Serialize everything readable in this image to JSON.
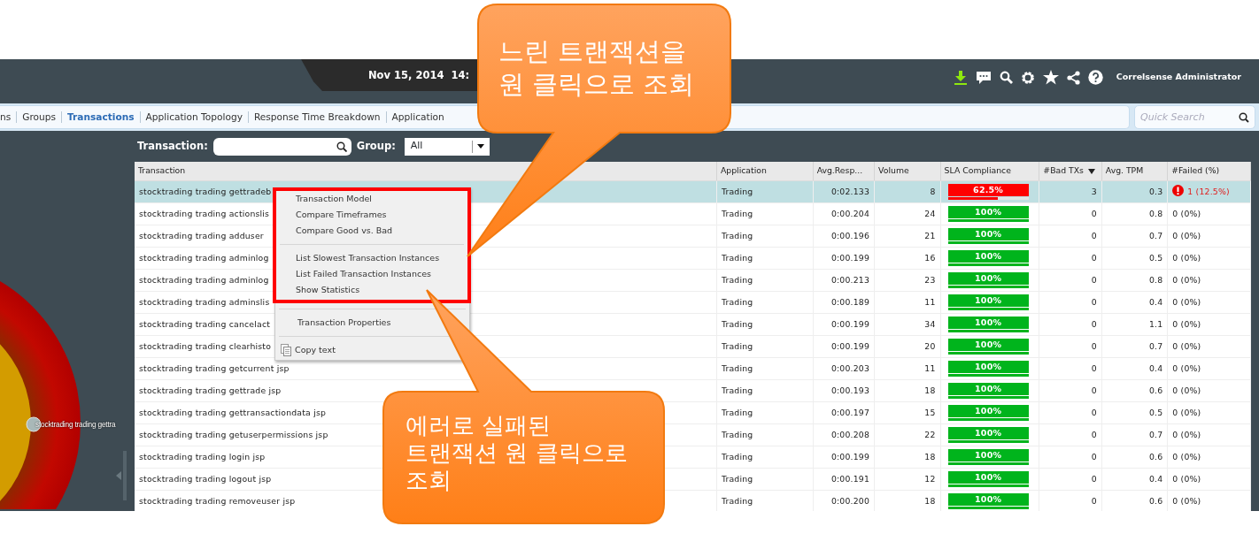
{
  "header": {
    "date": "Nov 15, 2014  14:",
    "user": "Correlsense Administrator"
  },
  "nav": {
    "items": [
      {
        "label": "ns",
        "selected": false
      },
      {
        "label": "Groups",
        "selected": false
      },
      {
        "label": "Transactions",
        "selected": true
      },
      {
        "label": "Application Topology",
        "selected": false
      },
      {
        "label": "Response Time Breakdown",
        "selected": false
      },
      {
        "label": "Application",
        "selected": false
      }
    ],
    "search_placeholder": "Quick Search"
  },
  "graph": {
    "node_label": "stocktrading trading gettra"
  },
  "filters": {
    "transaction_label": "Transaction:",
    "group_label": "Group:",
    "group_value": "All"
  },
  "table": {
    "columns": [
      {
        "label": "Transaction",
        "sorted": false
      },
      {
        "label": "Application",
        "sorted": false
      },
      {
        "label": "Avg.Resp...",
        "sorted": false
      },
      {
        "label": "Volume",
        "sorted": false
      },
      {
        "label": "SLA Compliance",
        "sorted": false
      },
      {
        "label": "#Bad TXs",
        "sorted": true
      },
      {
        "label": "Avg. TPM",
        "sorted": false
      },
      {
        "label": "#Failed (%)",
        "sorted": false
      }
    ],
    "rows": [
      {
        "name": "stocktrading trading gettradeb",
        "application": "Trading",
        "avg_resp": "0:02.133",
        "volume": "8",
        "sla": {
          "text": "62.5%",
          "level": 0.625,
          "color": "#fe0000"
        },
        "bad_txs": "3",
        "avg_tpm": "0.3",
        "failed": "1 (12.5%)",
        "failed_alert": true,
        "selected": true
      },
      {
        "name": "stocktrading trading actionslis",
        "application": "Trading",
        "avg_resp": "0:00.204",
        "volume": "24",
        "sla": {
          "text": "100%",
          "level": 1,
          "color": "#00b41c"
        },
        "bad_txs": "0",
        "avg_tpm": "0.8",
        "failed": "0 (0%)",
        "failed_alert": false,
        "selected": false
      },
      {
        "name": "stocktrading trading adduser",
        "application": "Trading",
        "avg_resp": "0:00.196",
        "volume": "21",
        "sla": {
          "text": "100%",
          "level": 1,
          "color": "#00b41c"
        },
        "bad_txs": "0",
        "avg_tpm": "0.7",
        "failed": "0 (0%)",
        "failed_alert": false,
        "selected": false
      },
      {
        "name": "stocktrading trading adminlog",
        "application": "Trading",
        "avg_resp": "0:00.199",
        "volume": "16",
        "sla": {
          "text": "100%",
          "level": 1,
          "color": "#00b41c"
        },
        "bad_txs": "0",
        "avg_tpm": "0.5",
        "failed": "0 (0%)",
        "failed_alert": false,
        "selected": false
      },
      {
        "name": "stocktrading trading adminlog",
        "application": "Trading",
        "avg_resp": "0:00.213",
        "volume": "23",
        "sla": {
          "text": "100%",
          "level": 1,
          "color": "#00b41c"
        },
        "bad_txs": "0",
        "avg_tpm": "0.8",
        "failed": "0 (0%)",
        "failed_alert": false,
        "selected": false
      },
      {
        "name": "stocktrading trading adminslis",
        "application": "Trading",
        "avg_resp": "0:00.189",
        "volume": "11",
        "sla": {
          "text": "100%",
          "level": 1,
          "color": "#00b41c"
        },
        "bad_txs": "0",
        "avg_tpm": "0.4",
        "failed": "0 (0%)",
        "failed_alert": false,
        "selected": false
      },
      {
        "name": "stocktrading trading cancelact",
        "application": "Trading",
        "avg_resp": "0:00.199",
        "volume": "34",
        "sla": {
          "text": "100%",
          "level": 1,
          "color": "#00b41c"
        },
        "bad_txs": "0",
        "avg_tpm": "1.1",
        "failed": "0 (0%)",
        "failed_alert": false,
        "selected": false
      },
      {
        "name": "stocktrading trading clearhisto",
        "application": "Trading",
        "avg_resp": "0:00.199",
        "volume": "20",
        "sla": {
          "text": "100%",
          "level": 1,
          "color": "#00b41c"
        },
        "bad_txs": "0",
        "avg_tpm": "0.7",
        "failed": "0 (0%)",
        "failed_alert": false,
        "selected": false
      },
      {
        "name": "stocktrading trading getcurrent jsp",
        "application": "Trading",
        "avg_resp": "0:00.203",
        "volume": "11",
        "sla": {
          "text": "100%",
          "level": 1,
          "color": "#00b41c"
        },
        "bad_txs": "0",
        "avg_tpm": "0.4",
        "failed": "0 (0%)",
        "failed_alert": false,
        "selected": false
      },
      {
        "name": "stocktrading trading gettrade jsp",
        "application": "Trading",
        "avg_resp": "0:00.193",
        "volume": "18",
        "sla": {
          "text": "100%",
          "level": 1,
          "color": "#00b41c"
        },
        "bad_txs": "0",
        "avg_tpm": "0.6",
        "failed": "0 (0%)",
        "failed_alert": false,
        "selected": false
      },
      {
        "name": "stocktrading trading gettransactiondata jsp",
        "application": "Trading",
        "avg_resp": "0:00.197",
        "volume": "15",
        "sla": {
          "text": "100%",
          "level": 1,
          "color": "#00b41c"
        },
        "bad_txs": "0",
        "avg_tpm": "0.5",
        "failed": "0 (0%)",
        "failed_alert": false,
        "selected": false
      },
      {
        "name": "stocktrading trading getuserpermissions jsp",
        "application": "Trading",
        "avg_resp": "0:00.208",
        "volume": "22",
        "sla": {
          "text": "100%",
          "level": 1,
          "color": "#00b41c"
        },
        "bad_txs": "0",
        "avg_tpm": "0.7",
        "failed": "0 (0%)",
        "failed_alert": false,
        "selected": false
      },
      {
        "name": "stocktrading trading login jsp",
        "application": "Trading",
        "avg_resp": "0:00.199",
        "volume": "18",
        "sla": {
          "text": "100%",
          "level": 1,
          "color": "#00b41c"
        },
        "bad_txs": "0",
        "avg_tpm": "0.6",
        "failed": "0 (0%)",
        "failed_alert": false,
        "selected": false
      },
      {
        "name": "stocktrading trading logout jsp",
        "application": "Trading",
        "avg_resp": "0:00.191",
        "volume": "12",
        "sla": {
          "text": "100%",
          "level": 1,
          "color": "#00b41c"
        },
        "bad_txs": "0",
        "avg_tpm": "0.4",
        "failed": "0 (0%)",
        "failed_alert": false,
        "selected": false
      },
      {
        "name": "stocktrading trading removeuser jsp",
        "application": "Trading",
        "avg_resp": "0:00.200",
        "volume": "18",
        "sla": {
          "text": "100%",
          "level": 1,
          "color": "#00b41c"
        },
        "bad_txs": "0",
        "avg_tpm": "0.6",
        "failed": "0 (0%)",
        "failed_alert": false,
        "selected": false
      }
    ]
  },
  "context_menu": {
    "groups": [
      {
        "highlighted": true,
        "items": [
          {
            "label": "Transaction Model",
            "kind": "plain"
          },
          {
            "label": "Compare Timeframes",
            "kind": "plain"
          },
          {
            "label": "Compare Good vs. Bad",
            "kind": "plain"
          }
        ]
      },
      {
        "highlighted": true,
        "items": [
          {
            "label": "List Slowest Transaction Instances",
            "kind": "plain"
          },
          {
            "label": "List Failed Transaction Instances",
            "kind": "plain"
          },
          {
            "label": "Show Statistics",
            "kind": "plain"
          }
        ]
      },
      {
        "highlighted": false,
        "items": [
          {
            "label": "Transaction Properties",
            "kind": "plain"
          }
        ]
      },
      {
        "highlighted": false,
        "items": [
          {
            "label": "Copy text",
            "kind": "copy"
          }
        ]
      }
    ]
  },
  "callouts": [
    {
      "lines": [
        "느린 트랜잭션을",
        "원 클릭으로 조회"
      ]
    },
    {
      "lines": [
        "에러로 실패된",
        "트랜잭션 원 클릭으로",
        "조회"
      ]
    }
  ]
}
